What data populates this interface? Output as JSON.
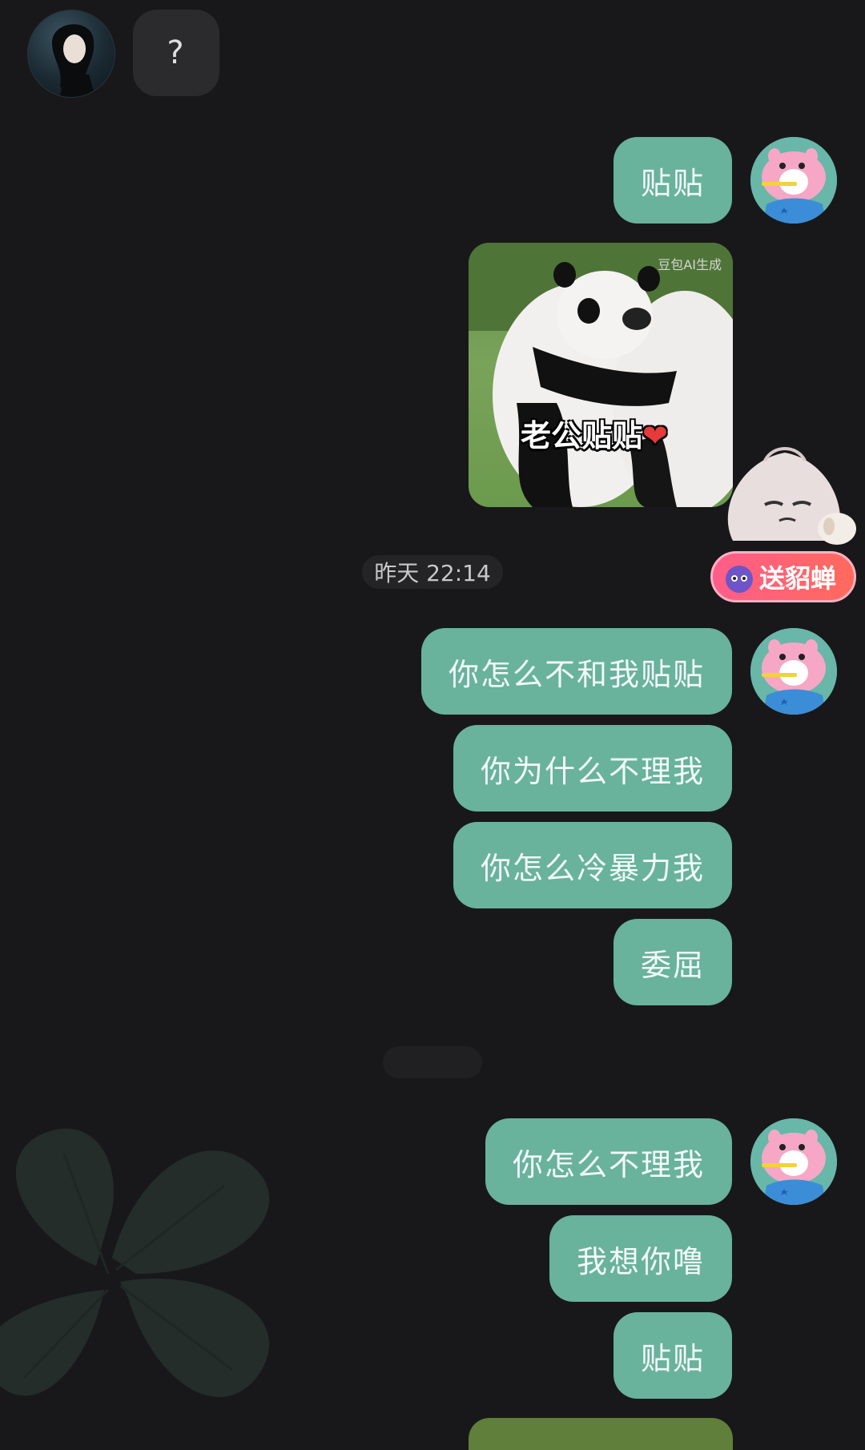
{
  "chat": {
    "incoming": [
      {
        "text": "?"
      }
    ],
    "outgoing_group1": [
      "贴贴"
    ],
    "sticker": {
      "caption": "老公贴贴",
      "watermark": "豆包AI生成"
    },
    "gift_button": {
      "label": "送貂蝉"
    },
    "timestamp": "昨天 22:14",
    "outgoing_group2": [
      "你怎么不和我贴贴",
      "你为什么不理我",
      "你怎么冷暴力我",
      "委屈"
    ],
    "outgoing_group3": [
      "你怎么不理我",
      "我想你噜",
      "贴贴"
    ]
  },
  "colors": {
    "background": "#18181a",
    "outgoing_bubble": "#69b29c",
    "incoming_bubble": "#2b2b2d",
    "gift_button": "#ff5d8a"
  },
  "icons": {
    "left_avatar": "woman-photo-avatar",
    "right_avatar": "pig-cartoon-avatar",
    "gift": "monster-gift-icon",
    "mascot": "rice-dumpling-mascot"
  }
}
